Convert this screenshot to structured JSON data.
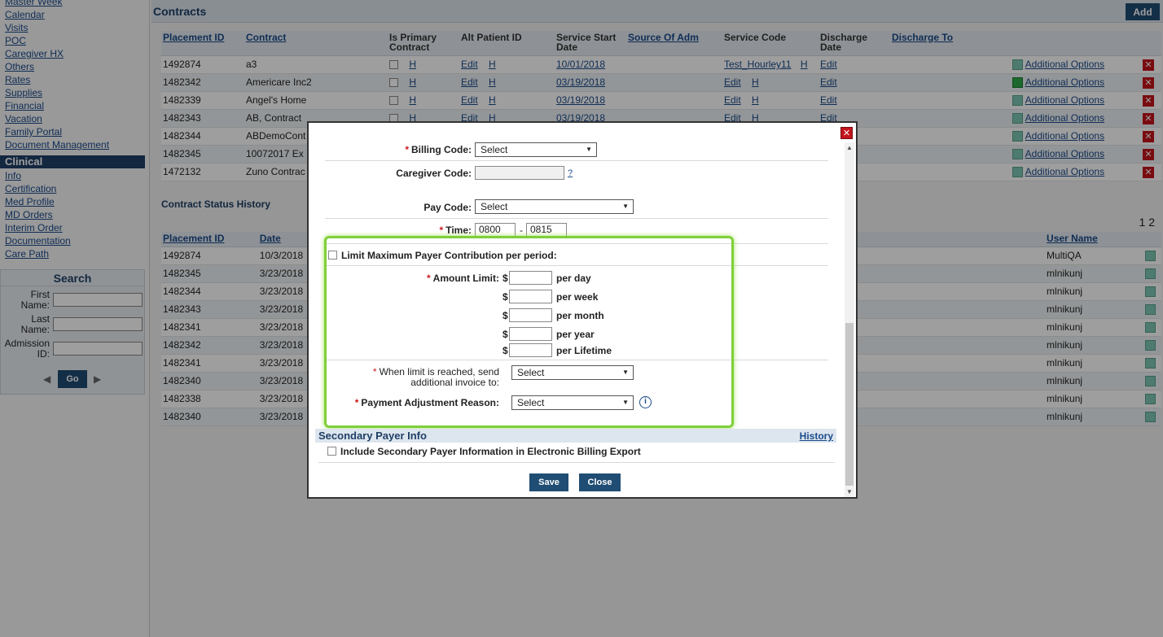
{
  "sidebar": {
    "top_links": [
      "Master Week",
      "Calendar",
      "Visits",
      "POC",
      "Caregiver HX",
      "Others",
      "Rates",
      "Supplies",
      "Financial",
      "Vacation",
      "Family Portal",
      "Document Management"
    ],
    "clinical_header": "Clinical",
    "clinical_links": [
      "Info",
      "Certification",
      "Med Profile",
      "MD Orders",
      "Interim Order",
      "Documentation",
      "Care Path"
    ],
    "search": {
      "title": "Search",
      "first_name_label": "First Name:",
      "last_name_label": "Last Name:",
      "admission_label": "Admission ID:",
      "go_label": "Go"
    }
  },
  "contracts": {
    "title": "Contracts",
    "add_label": "Add",
    "columns": [
      "Placement ID",
      "Contract",
      "Is Primary Contract",
      "Alt Patient ID",
      "Service Start Date",
      "Source Of Adm",
      "Service Code",
      "Discharge Date",
      "Discharge To"
    ],
    "rows": [
      {
        "id": "1492874",
        "contract": "a3",
        "alt": "Edit",
        "start": "10/01/2018",
        "svc": "Test_Hourley11",
        "dis": "Edit",
        "opt": "Additional Options"
      },
      {
        "id": "1482342",
        "contract": "Americare Inc2",
        "alt": "Edit",
        "start": "03/19/2018",
        "svc": "Edit",
        "dis": "Edit",
        "opt": "Additional Options"
      },
      {
        "id": "1482339",
        "contract": "Angel's Home",
        "alt": "Edit",
        "start": "03/19/2018",
        "svc": "Edit",
        "dis": "Edit",
        "opt": "Additional Options"
      },
      {
        "id": "1482343",
        "contract": "AB, Contract",
        "alt": "Edit",
        "start": "03/19/2018",
        "svc": "Edit",
        "dis": "Edit",
        "opt": "Additional Options"
      },
      {
        "id": "1482344",
        "contract": "ABDemoCont",
        "alt": "",
        "start": "",
        "svc": "",
        "dis": "",
        "opt": "Additional Options"
      },
      {
        "id": "1482345",
        "contract": "10072017 Ex",
        "alt": "",
        "start": "",
        "svc": "",
        "dis": "",
        "opt": "Additional Options"
      },
      {
        "id": "1472132",
        "contract": "Zuno Contrac",
        "alt": "",
        "start": "",
        "svc": "",
        "dis": "",
        "opt": "Additional Options"
      }
    ],
    "h_label": "H"
  },
  "history": {
    "title": "Contract Status History",
    "pages": "1 2",
    "columns": [
      "Placement ID",
      "Date",
      "User Name"
    ],
    "rows": [
      {
        "id": "1492874",
        "date": "10/3/2018",
        "user": "MultiQA"
      },
      {
        "id": "1482345",
        "date": "3/23/2018",
        "user": "mlnikunj"
      },
      {
        "id": "1482344",
        "date": "3/23/2018",
        "user": "mlnikunj"
      },
      {
        "id": "1482343",
        "date": "3/23/2018",
        "user": "mlnikunj"
      },
      {
        "id": "1482341",
        "date": "3/23/2018",
        "user": "mlnikunj"
      },
      {
        "id": "1482342",
        "date": "3/23/2018",
        "user": "mlnikunj"
      },
      {
        "id": "1482341",
        "date": "3/23/2018",
        "user": "mlnikunj"
      },
      {
        "id": "1482340",
        "date": "3/23/2018",
        "user": "mlnikunj"
      },
      {
        "id": "1482338",
        "date": "3/23/2018",
        "user": "mlnikunj"
      },
      {
        "id": "1482340",
        "date": "3/23/2018",
        "user": "mlnikunj"
      }
    ]
  },
  "modal": {
    "billing_code_label": "Billing Code:",
    "billing_code_value": "Select",
    "caregiver_code_label": "Caregiver Code:",
    "caregiver_help": "?",
    "pay_code_label": "Pay Code:",
    "pay_code_value": "Select",
    "time_label": "Time:",
    "time_from": "0800",
    "time_sep": "-",
    "time_to": "0815",
    "limit_label": "Limit Maximum Payer Contribution per period:",
    "amount_limit_label": "Amount Limit:",
    "currency": "$",
    "periods": [
      "per day",
      "per week",
      "per month",
      "per year",
      "per Lifetime"
    ],
    "when_limit_label": "When limit is reached, send additional invoice to:",
    "when_limit_value": "Select",
    "adj_reason_label": "Payment Adjustment Reason:",
    "adj_reason_value": "Select",
    "info_icon_glyph": "i",
    "secondary_title": "Secondary Payer Info",
    "history_link": "History",
    "include_secondary_label": "Include Secondary Payer Information in Electronic Billing Export",
    "save_label": "Save",
    "close_label": "Close"
  },
  "colors": {
    "accent": "#1f4d73",
    "highlight": "#7fcf3a",
    "danger": "#c3141b"
  }
}
